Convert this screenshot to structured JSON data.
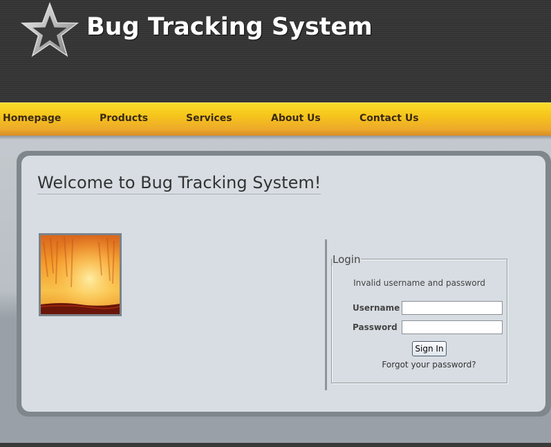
{
  "header": {
    "title": "Bug Tracking System",
    "logo_icon": "star-icon"
  },
  "nav": {
    "items": [
      {
        "label": "Homepage"
      },
      {
        "label": "Products"
      },
      {
        "label": "Services"
      },
      {
        "label": "About Us"
      },
      {
        "label": "Contact Us"
      }
    ]
  },
  "main": {
    "welcome": "Welcome to Bug Tracking System!",
    "image_icon": "fire-photo"
  },
  "login": {
    "legend": "Login",
    "message": "Invalid username and password",
    "username_label": "Username",
    "username_value": "",
    "password_label": "Password",
    "password_value": "",
    "sign_in_label": "Sign In",
    "forgot_label": "Forgot your password?"
  },
  "colors": {
    "header_bg": "#333333",
    "nav_accent": "#f6c51b",
    "panel_bg": "#d7dde2",
    "title_text": "#ffffff"
  }
}
